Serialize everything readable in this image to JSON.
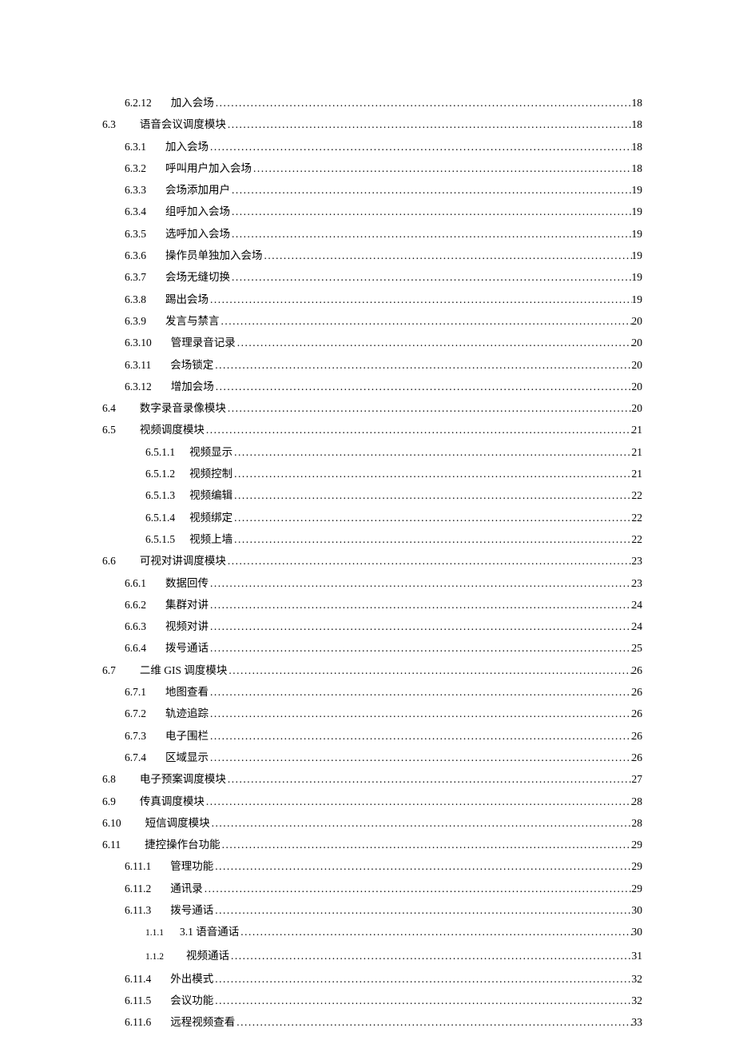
{
  "entries": [
    {
      "lvl": "lvl3",
      "num": "6.2.12",
      "title": "加入会场",
      "page": "18"
    },
    {
      "lvl": "lvl2",
      "num": "6.3",
      "title": "语音会议调度模块",
      "page": "18"
    },
    {
      "lvl": "lvl3",
      "num": "6.3.1",
      "title": "加入会场",
      "page": "18"
    },
    {
      "lvl": "lvl3",
      "num": "6.3.2",
      "title": "呼叫用户加入会场",
      "page": "18"
    },
    {
      "lvl": "lvl3",
      "num": "6.3.3",
      "title": "会场添加用户",
      "page": "19"
    },
    {
      "lvl": "lvl3",
      "num": "6.3.4",
      "title": "组呼加入会场",
      "page": "19"
    },
    {
      "lvl": "lvl3",
      "num": "6.3.5",
      "title": "选呼加入会场",
      "page": "19"
    },
    {
      "lvl": "lvl3",
      "num": "6.3.6",
      "title": "操作员单独加入会场",
      "page": "19"
    },
    {
      "lvl": "lvl3",
      "num": "6.3.7",
      "title": "会场无缝切换",
      "page": "19"
    },
    {
      "lvl": "lvl3",
      "num": "6.3.8",
      "title": "踢出会场",
      "page": "19"
    },
    {
      "lvl": "lvl3",
      "num": "6.3.9",
      "title": "发言与禁言",
      "page": "20"
    },
    {
      "lvl": "lvl3",
      "num": "6.3.10",
      "title": "管理录音记录",
      "page": "20"
    },
    {
      "lvl": "lvl3",
      "num": "6.3.11",
      "title": "会场锁定",
      "page": "20"
    },
    {
      "lvl": "lvl3",
      "num": "6.3.12",
      "title": "增加会场",
      "page": "20"
    },
    {
      "lvl": "lvl2",
      "num": "6.4",
      "title": "数字录音录像模块",
      "page": "20"
    },
    {
      "lvl": "lvl2",
      "num": "6.5",
      "title": "视频调度模块",
      "page": "21"
    },
    {
      "lvl": "lvl4",
      "num": "6.5.1.1",
      "title": "视频显示",
      "page": "21"
    },
    {
      "lvl": "lvl4",
      "num": "6.5.1.2",
      "title": "视频控制",
      "page": "21"
    },
    {
      "lvl": "lvl4",
      "num": "6.5.1.3",
      "title": "视频编辑",
      "page": "22"
    },
    {
      "lvl": "lvl4",
      "num": "6.5.1.4",
      "title": "视频绑定",
      "page": "22"
    },
    {
      "lvl": "lvl4",
      "num": "6.5.1.5",
      "title": "视频上墙",
      "page": "22"
    },
    {
      "lvl": "lvl2",
      "num": "6.6",
      "title": "可视对讲调度模块",
      "page": "23"
    },
    {
      "lvl": "lvl3",
      "num": "6.6.1",
      "title": "数据回传",
      "page": "23"
    },
    {
      "lvl": "lvl3",
      "num": "6.6.2",
      "title": "集群对讲",
      "page": "24"
    },
    {
      "lvl": "lvl3",
      "num": "6.6.3",
      "title": "视频对讲",
      "page": "24"
    },
    {
      "lvl": "lvl3",
      "num": "6.6.4",
      "title": "拨号通话",
      "page": "25"
    },
    {
      "lvl": "lvl2",
      "num": "6.7",
      "title": "二维 GIS 调度模块",
      "page": "26",
      "gisNote": true
    },
    {
      "lvl": "lvl3",
      "num": "6.7.1",
      "title": "地图查看",
      "page": "26"
    },
    {
      "lvl": "lvl3",
      "num": "6.7.2",
      "title": "轨迹追踪",
      "page": "26"
    },
    {
      "lvl": "lvl3",
      "num": "6.7.3",
      "title": "电子围栏",
      "page": "26"
    },
    {
      "lvl": "lvl3",
      "num": "6.7.4",
      "title": "区域显示",
      "page": "26"
    },
    {
      "lvl": "lvl2",
      "num": "6.8",
      "title": "电子预案调度模块",
      "page": "27"
    },
    {
      "lvl": "lvl2",
      "num": "6.9",
      "title": "传真调度模块",
      "page": "28"
    },
    {
      "lvl": "lvl2",
      "num": "6.10",
      "title": "短信调度模块",
      "page": "28"
    },
    {
      "lvl": "lvl2",
      "num": "6.11",
      "title": "捷控操作台功能",
      "page": "29"
    },
    {
      "lvl": "lvl3",
      "num": "6.11.1",
      "title": "管理功能",
      "page": "29"
    },
    {
      "lvl": "lvl3",
      "num": "6.11.2",
      "title": "通讯录",
      "page": "29"
    },
    {
      "lvl": "lvl3",
      "num": "6.11.3",
      "title": "拨号通话",
      "page": "30"
    },
    {
      "lvl": "lvl-alt",
      "num": "1.1.1",
      "title": "3.1  语音通话",
      "page": "30",
      "alt": true
    },
    {
      "lvl": "lvl-alt",
      "num": "1.1.2",
      "title": "视频通话",
      "page": "31",
      "alt": true
    },
    {
      "lvl": "lvl3",
      "num": "6.11.4",
      "title": "外出模式",
      "page": "32"
    },
    {
      "lvl": "lvl3",
      "num": "6.11.5",
      "title": "会议功能",
      "page": "32"
    },
    {
      "lvl": "lvl3",
      "num": "6.11.6",
      "title": "远程视频查看",
      "page": "33"
    }
  ],
  "dots": "........................................................................................................................................................................................................"
}
